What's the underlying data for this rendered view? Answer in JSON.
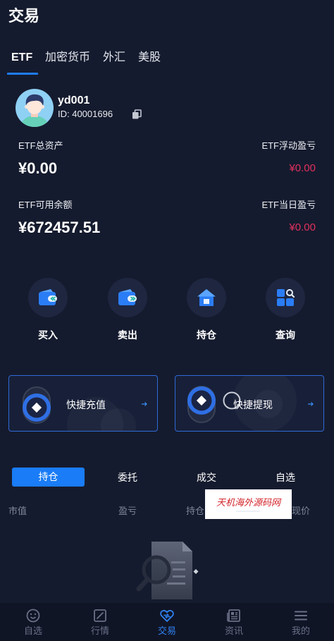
{
  "header": {
    "title": "交易"
  },
  "tabs": [
    {
      "label": "ETF"
    },
    {
      "label": "加密货币"
    },
    {
      "label": "外汇"
    },
    {
      "label": "美股"
    }
  ],
  "user": {
    "avatar_icon": "user-avatar",
    "name": "yd001",
    "id_text": "ID: 40001696",
    "copy_icon": "copy-icon"
  },
  "assets": {
    "total": {
      "label": "ETF总资产",
      "value": "¥0.00"
    },
    "floating_pnl": {
      "label": "ETF浮动盈亏",
      "value": "¥0.00"
    },
    "available": {
      "label": "ETF可用余额",
      "value": "¥672457.51"
    },
    "daily_pnl": {
      "label": "ETF当日盈亏",
      "value": "¥0.00"
    }
  },
  "actions": [
    {
      "label": "买入",
      "icon": "wallet-in-icon"
    },
    {
      "label": "卖出",
      "icon": "wallet-out-icon"
    },
    {
      "label": "持仓",
      "icon": "house-icon"
    },
    {
      "label": "查询",
      "icon": "grid-search-icon"
    }
  ],
  "quick_cards": [
    {
      "label": "快捷充值",
      "icon": "coin-icon"
    },
    {
      "label": "快捷提现",
      "icon": "coin-icon"
    }
  ],
  "sub_tabs": [
    {
      "label": "持仓"
    },
    {
      "label": "委托"
    },
    {
      "label": "成交"
    },
    {
      "label": "自选"
    }
  ],
  "columns": [
    "市值",
    "盈亏",
    "持仓",
    "现价"
  ],
  "watermark": {
    "text": "天机海外源码网"
  },
  "empty_state": {
    "icon": "no-data-icon"
  },
  "bottom_nav": [
    {
      "label": "自选",
      "icon": "smile-icon"
    },
    {
      "label": "行情",
      "icon": "chart-icon"
    },
    {
      "label": "交易",
      "icon": "trade-icon"
    },
    {
      "label": "资讯",
      "icon": "news-icon"
    },
    {
      "label": "我的",
      "icon": "menu-icon"
    }
  ],
  "colors": {
    "background": "#151b2e",
    "accent": "#1f7cf5",
    "loss": "#e0305e",
    "card_border": "#2f6ad8"
  }
}
